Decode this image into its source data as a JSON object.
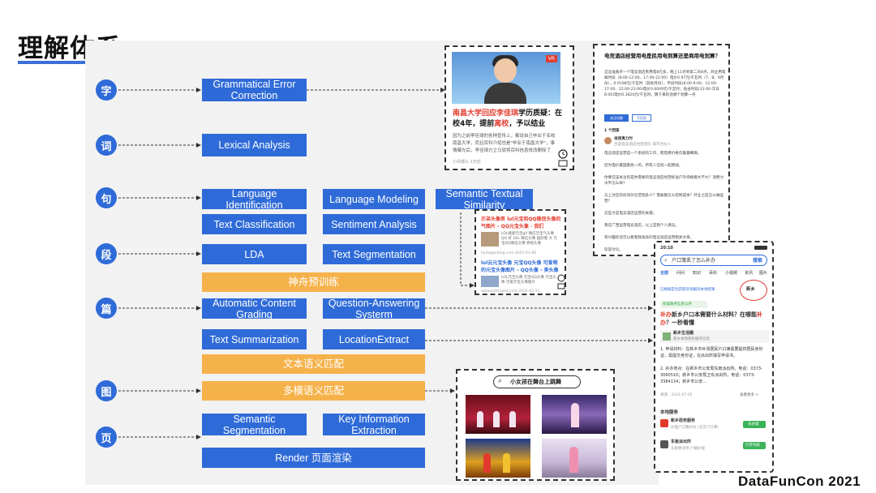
{
  "title": "理解体系",
  "levels": [
    "字",
    "词",
    "句",
    "段",
    "篇",
    "图",
    "页"
  ],
  "tasks": {
    "gec": "Grammatical Error Correction",
    "lexical": "Lexical Analysis",
    "lang_id": "Language Identification",
    "lang_model": "Language Modeling",
    "sts": "Semantic Textual Similarity",
    "text_cls": "Text Classification",
    "sentiment": "Sentiment Analysis",
    "lda": "LDA",
    "text_seg": "Text Segmentation",
    "pretrain": "神舟预训练",
    "auto_grading": "Automatic Content Grading",
    "qa": "Question-Answering Systerm",
    "summarization": "Text Summarization",
    "location": "LocationExtract",
    "text_match": "文本语义匹配",
    "multimodal_match": "多模语义匹配",
    "sem_seg": "Semantic Segmentation",
    "kie": "Key Information Extraction",
    "render": "Render 页面渲染"
  },
  "card_news": {
    "badge": "VR",
    "title_parts": [
      "南昌大学回应",
      "李佳琪",
      "学历质疑：在校4年，提前",
      "离校",
      "，予以结业"
    ],
    "body": "因为之前李佳琦的各种宣传上，都说自己毕业于名校南昌大学，而且百科介绍也是\"毕业于南昌大学\"，事情曝光后，李佳琦方立马就将百科信息修改删除了",
    "meta": "小师傅头  1天前"
  },
  "card_search": {
    "item1_title": "示弟头像男 lol元宝和QQ微信头像的气图片 - QQ元宝头像 · 我们",
    "item1_body": "LOL搜索元宝gif 微信元宝气头像QQ 好 LOL 微信头像 超好看 大 元宝QQ微信头像 原始头像",
    "item1_source": "hymeguiding.com  2021-01-06",
    "item2_title": "lol云元宝头像 元宝QQ头像 可爱萌的元宝头像图片 - QQ头像 - 美头像",
    "item2_body": "LOL元宝头像 元宝QQ头像 元宝头像 可爱元宝头像图片",
    "item2_source": "www.kidshome.com  2021-02-21"
  },
  "card_qa": {
    "title": "电竞酒店经营用电是民用电到算还是商用电划算？",
    "body": "这边准备开一个电竞酒店民用电8元多，晚上11点到第二天8点，商业用电峰时段（8:00-12:00、17:00-22:00）电价0.97元/千瓦时（7、8、9月份），0.9198元/千瓦时（其他月份）；平段时段(8:00-9:00、12:00-17:00、22:00-23:00)电价0.6049元/千瓦时；低谷时段(23:00-次日8:00)电价0.3820元/千瓦时。算下来的话哪个划算一点",
    "btn_primary": "关注问题",
    "btn_secondary": "写回答",
    "answers_count": "1 个回答",
    "answerer": "谁搜真力时",
    "answerer_desc": "百度电竞酒店经营团队  城市合伙人",
    "lines": [
      "电竞酒店运营是一个系统的工作，而电费价格仅最最细微。",
      "因为电价最国家统一的，所有人在统一起跑线。",
      "你要在该关注的是你需要的电竞酒店经营标准户外场规模大不大？消费力水平怎么样？",
      "与上对应的房间价位范围多少？需备额怎么控制成本？开业之后怎么做运营？",
      "这些才是电竞酒店运营的关键。",
      "我在广西运营电竞酒店，以上是我个人建议。",
      "有兴趣的话可以看看我发表的电竞酒店运营相关文章。",
      "欢迎讨论。"
    ]
  },
  "card_phone": {
    "time": "20:10",
    "search_placeholder": "户口簿丢了怎么补办",
    "search_button": "搜索",
    "tabs": [
      "全部",
      "问问",
      "知识",
      "百科",
      "小视频",
      "资讯",
      "图片"
    ],
    "location_bar": "已根据定位获取您地服同本地结果",
    "location_tag": "新乡",
    "cert_label": "权威政务信息公开",
    "headline_parts": [
      "补办",
      "新乡户口本需要什么材料？在哪能",
      "补办",
      "？一秒看懂"
    ],
    "source_name": "新乡生活圈",
    "source_desc": "新乡本地便民服务信息",
    "steps": [
      "1. 申请材料：在新乡市补领居民户口簿需要提供居民身份证，需提交身份证，在派出所填写申请书。",
      "2. 补办地点：在新乡市公安局东南派出所。电话：0373-3060510；新乡市公安局卫东派出所，电话：0373-3384134；新乡市公安..."
    ],
    "date": "来源：2021-07-05",
    "more": "查看更多 >",
    "local_services": "本地服务",
    "service1": "新乡政务服务",
    "service1_desc": "办理户口簿补办 (北京户口簿)",
    "service1_btn": "去办理",
    "service2": "东板派出所",
    "service2_desc": "东板路北侧 户籍办理",
    "service2_btn": "打开导航"
  },
  "card_images": {
    "query": "小女孩在舞台上跳舞"
  },
  "brand": "DataFunCon 2021"
}
